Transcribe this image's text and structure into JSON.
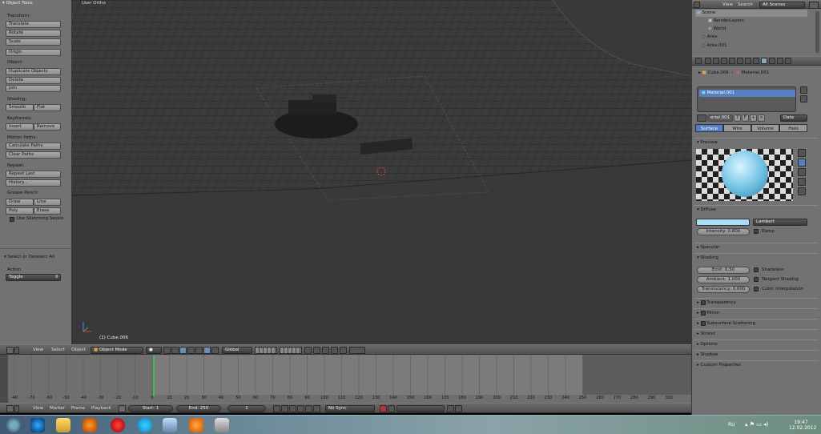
{
  "tools": {
    "title": "Object Tools",
    "transform_label": "Transform:",
    "translate": "Translate",
    "rotate": "Rotate",
    "scale": "Scale",
    "origin": "Origin",
    "object_label": "Object:",
    "duplicate": "Duplicate Objects",
    "delete": "Delete",
    "join": "Join",
    "shading_label": "Shading:",
    "smooth": "Smooth",
    "flat": "Flat",
    "keyframes_label": "Keyframes:",
    "insert": "Insert",
    "remove": "Remove",
    "motion_label": "Motion Paths:",
    "calc_paths": "Calculate Paths",
    "clear_paths": "Clear Paths",
    "repeat_label": "Repeat:",
    "repeat_last": "Repeat Last",
    "history": "History...",
    "grease_label": "Grease Pencil:",
    "draw": "Draw",
    "line": "Line",
    "poly": "Poly",
    "erase": "Erase",
    "sketch": "Use Sketching Sessio",
    "op_title": "Select or Deselect All",
    "action_label": "Action",
    "action_value": "Toggle"
  },
  "viewport": {
    "view_name": "User Ortho",
    "object_name": "(1) Cube.006"
  },
  "view_header": {
    "view": "View",
    "select": "Select",
    "object": "Object",
    "mode": "Object Mode",
    "orientation": "Global"
  },
  "timeline": {
    "ticks": [
      "-40",
      "-70",
      "-60",
      "-50",
      "-40",
      "-30",
      "-20",
      "-10",
      "0",
      "10",
      "20",
      "30",
      "40",
      "50",
      "60",
      "70",
      "80",
      "90",
      "100",
      "110",
      "120",
      "130",
      "140",
      "150",
      "160",
      "170",
      "180",
      "190",
      "200",
      "210",
      "220",
      "230",
      "240",
      "250",
      "260",
      "270",
      "280",
      "290",
      "300"
    ]
  },
  "tl_header": {
    "view": "View",
    "marker": "Marker",
    "frame": "Frame",
    "playback": "Playback",
    "start": "Start: 1",
    "end": "End: 250",
    "current": "1",
    "sync": "No Sync"
  },
  "outliner": {
    "view": "View",
    "search": "Search",
    "scenes": "All Scenes",
    "items": [
      "Scene",
      "RenderLayers",
      "World",
      "Area",
      "Area.001"
    ]
  },
  "props": {
    "crumb_obj": "Cube.006",
    "crumb_mat": "Material.001",
    "material_slot": "Material.001",
    "mat_field": "erial.001",
    "mat_users": "7",
    "data_select": "Data",
    "tabs": [
      "Surface",
      "Wire",
      "Volume",
      "Halo"
    ],
    "preview_label": "Preview",
    "diffuse_label": "Diffuse",
    "shader": "Lambert",
    "intensity": "Intensity: 0.800",
    "ramp": "Ramp",
    "specular_label": "Specular",
    "shading_label": "Shading",
    "emit": "Emit: 0.50",
    "shadeless": "Shadeless",
    "ambient": "Ambient: 1.000",
    "tangent": "Tangent Shading",
    "translucency": "Translucency: 0.000",
    "cubic": "Cubic Interpolation",
    "collapsed": [
      "Transparency",
      "Mirror",
      "Subsurface Scattering",
      "Strand",
      "Options",
      "Shadow",
      "Custom Properties"
    ],
    "diffuse_color": "#a9dcf5"
  },
  "taskbar": {
    "lang": "RU",
    "time": "19:47",
    "date": "12.02.2012"
  }
}
